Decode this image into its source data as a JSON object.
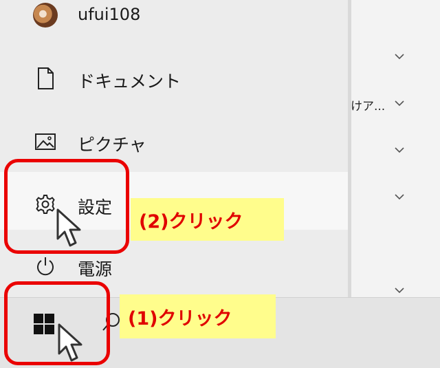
{
  "user": {
    "name": "ufui108"
  },
  "menu": {
    "items": [
      {
        "label": "ドキュメント",
        "icon": "document-icon"
      },
      {
        "label": "ピクチャ",
        "icon": "pictures-icon"
      },
      {
        "label": "設定",
        "icon": "gear-icon"
      },
      {
        "label": "電源",
        "icon": "power-icon"
      }
    ]
  },
  "background": {
    "truncated_text": "けア..."
  },
  "annotations": {
    "step1": "(1)クリック",
    "step2": "(2)クリック",
    "box_color": "#ea0000",
    "callout_bg": "#fffd8c",
    "callout_text_color": "#e00000"
  },
  "taskbar": {
    "start_icon": "windows-logo-icon"
  }
}
